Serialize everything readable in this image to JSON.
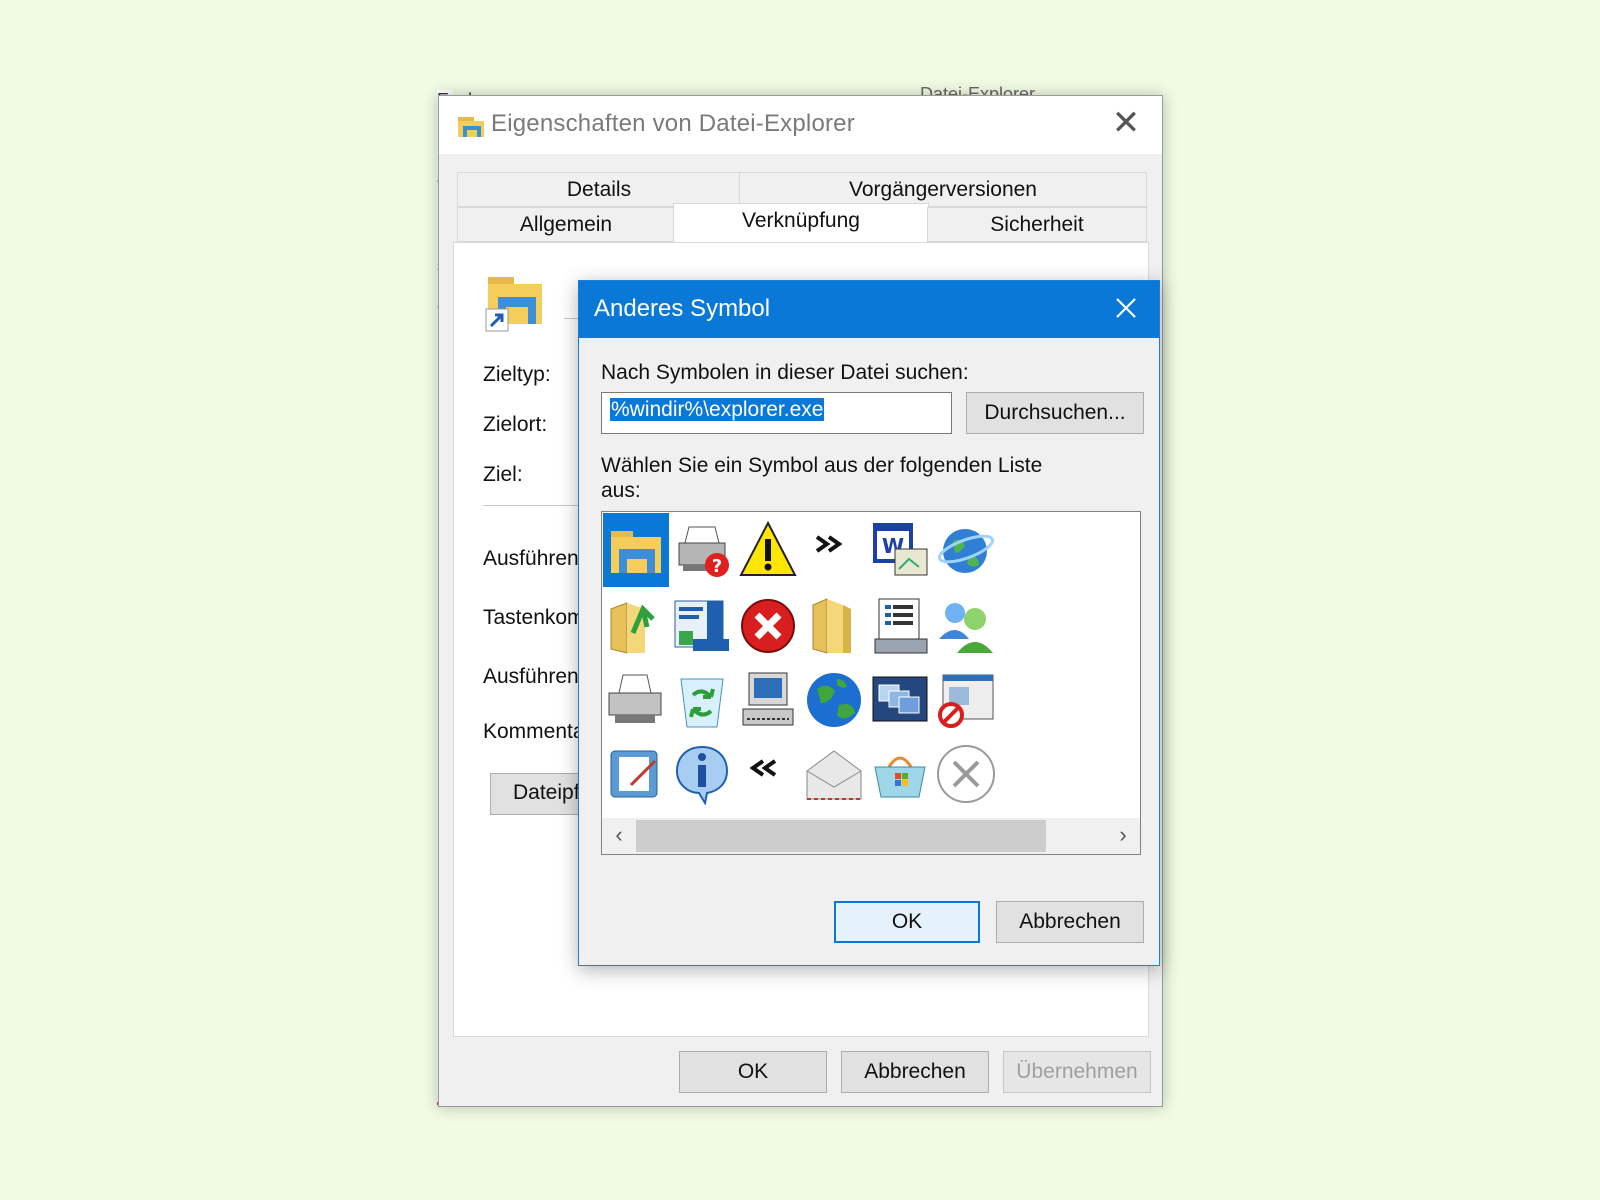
{
  "background_window": {
    "title_fragment": "Explorer",
    "right_text_fragment": "Datei-Explorer",
    "side_letters": [
      "t",
      "r",
      "s",
      "a"
    ]
  },
  "properties_dialog": {
    "title": "Eigenschaften von Datei-Explorer",
    "tabs_back": [
      "Details",
      "Vorgängerversionen"
    ],
    "tabs_front": [
      "Allgemein",
      "Verknüpfung",
      "Sicherheit"
    ],
    "active_tab": "Verknüpfung",
    "labels": {
      "zieltyp": "Zieltyp:",
      "zielort": "Zielort:",
      "ziel": "Ziel:",
      "ausfuehren_in": "Ausführen",
      "tastenkombination": "Tastenkom",
      "ausfuehren": "Ausführen",
      "kommentar": "Kommenta"
    },
    "dateipfad_button": "Dateipf",
    "buttons": {
      "ok": "OK",
      "cancel": "Abbrechen",
      "apply": "Übernehmen"
    }
  },
  "symbol_dialog": {
    "title": "Anderes Symbol",
    "search_label": "Nach Symbolen in dieser Datei suchen:",
    "file_path": "%windir%\\explorer.exe",
    "browse_button": "Durchsuchen...",
    "list_label": "Wählen Sie ein Symbol aus der folgenden Liste aus:",
    "selected_icon_index": 0,
    "icons": [
      "file-explorer-icon",
      "printer-help-icon",
      "warning-icon",
      "chevron-right-double-icon",
      "window-form-icon",
      "internet-globe-icon",
      "folder-up-icon",
      "control-panel-icon",
      "error-icon",
      "folder-icon",
      "computer-list-icon",
      "users-icon",
      "printer-icon",
      "recycle-bin-icon",
      "computer-icon",
      "globe-icon",
      "windows-stack-icon",
      "blocked-window-icon",
      "edit-document-icon",
      "info-icon",
      "chevron-left-double-icon",
      "envelope-icon",
      "shopping-basket-icon",
      "close-circle-icon"
    ],
    "buttons": {
      "ok": "OK",
      "cancel": "Abbrechen"
    }
  },
  "colors": {
    "accent": "#0a78d6",
    "page_background": "#f0fbe2"
  }
}
